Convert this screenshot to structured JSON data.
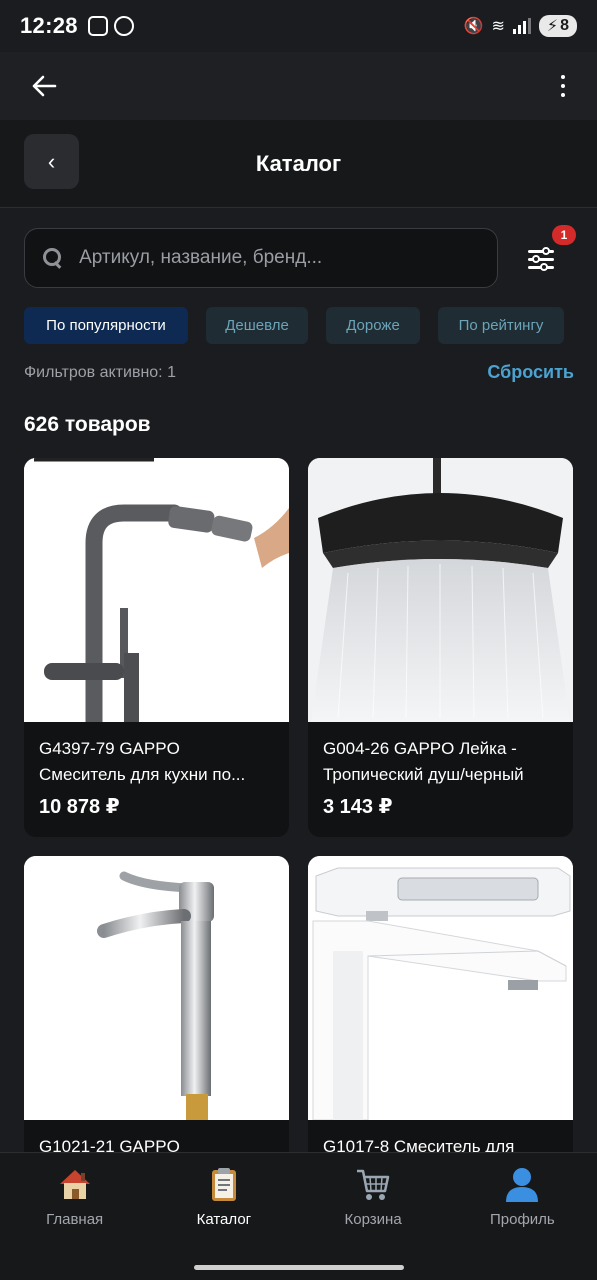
{
  "status": {
    "time": "12:28",
    "battery": "8"
  },
  "header": {
    "title": "Каталог"
  },
  "search": {
    "placeholder": "Артикул, название, бренд..."
  },
  "filter": {
    "badge": "1"
  },
  "sort_chips": [
    {
      "label": "По популярности",
      "active": true
    },
    {
      "label": "Дешевле",
      "active": false
    },
    {
      "label": "Дороже",
      "active": false
    },
    {
      "label": "По рейтингу",
      "active": false
    }
  ],
  "filters_info": {
    "text": "Фильтров активно: 1",
    "reset_label": "Сбросить"
  },
  "results": {
    "count_label": "626 товаров"
  },
  "products": [
    {
      "line1": "G4397-79 GAPPO",
      "line2": "Смеситель для кухни по...",
      "price": "10 878 ₽",
      "image": "kitchen-faucet-image"
    },
    {
      "line1": "G004-26 GAPPO Лейка -",
      "line2": "Тропический душ/черный",
      "price": "3 143 ₽",
      "image": "shower-head-image"
    },
    {
      "line1": "G1021-21 GAPPO",
      "line2": "",
      "price": "",
      "image": "chrome-faucet-image"
    },
    {
      "line1": "G1017-8 Смеситель для",
      "line2": "",
      "price": "",
      "image": "white-faucet-image"
    }
  ],
  "nav": [
    {
      "label": "Главная",
      "icon": "home-icon",
      "active": false
    },
    {
      "label": "Каталог",
      "icon": "clipboard-icon",
      "active": true
    },
    {
      "label": "Корзина",
      "icon": "cart-icon",
      "active": false
    },
    {
      "label": "Профиль",
      "icon": "profile-icon",
      "active": false
    }
  ],
  "colors": {
    "accent": "#4ba3d1",
    "chip_active_bg": "#0e2a52",
    "badge": "#d52a2a"
  }
}
